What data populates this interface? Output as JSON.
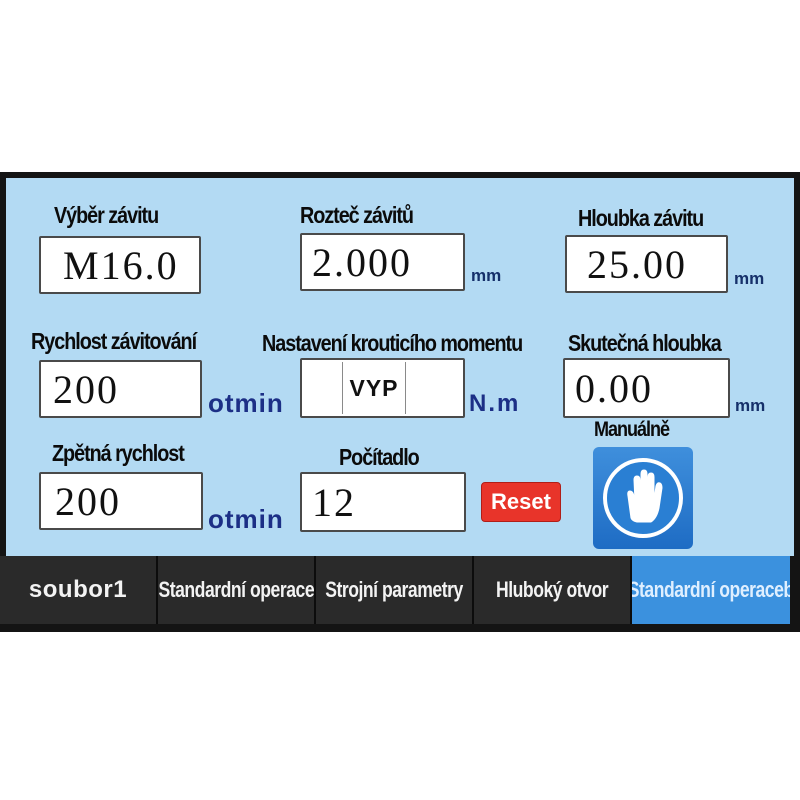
{
  "fields": {
    "thread_selection": {
      "label": "Výběr závitu",
      "value": "M16.0"
    },
    "thread_pitch": {
      "label": "Rozteč závitů",
      "value": "2.000",
      "unit": "mm"
    },
    "thread_depth": {
      "label": "Hloubka závitu",
      "value": "25.00",
      "unit": "mm"
    },
    "tapping_speed": {
      "label": "Rychlost závitování",
      "value": "200",
      "unit": "otmin"
    },
    "torque_setting": {
      "label": "Nastavení krouticího momentu",
      "value": "VYP",
      "unit": "N.m"
    },
    "actual_depth": {
      "label": "Skutečná hloubka",
      "value": "0.00",
      "unit": "mm"
    },
    "return_speed": {
      "label": "Zpětná rychlost",
      "value": "200",
      "unit": "otmin"
    },
    "counter": {
      "label": "Počítadlo",
      "value": "12"
    }
  },
  "buttons": {
    "reset_label": "Reset",
    "manual_label": "Manuálně"
  },
  "tabs": [
    {
      "label": "soubor1",
      "active": false
    },
    {
      "label": "Standardní operace",
      "active": false
    },
    {
      "label": "Strojní parametry",
      "active": false
    },
    {
      "label": "Hluboký otvor",
      "active": false
    },
    {
      "label": "Standardní operaceb",
      "active": true
    }
  ],
  "colors": {
    "panel": "#b3daf3",
    "active_tab": "#3b91de",
    "reset": "#e8342a",
    "unit_text": "#1c2f86"
  },
  "icons": {
    "manual": "hand-stop-icon"
  }
}
